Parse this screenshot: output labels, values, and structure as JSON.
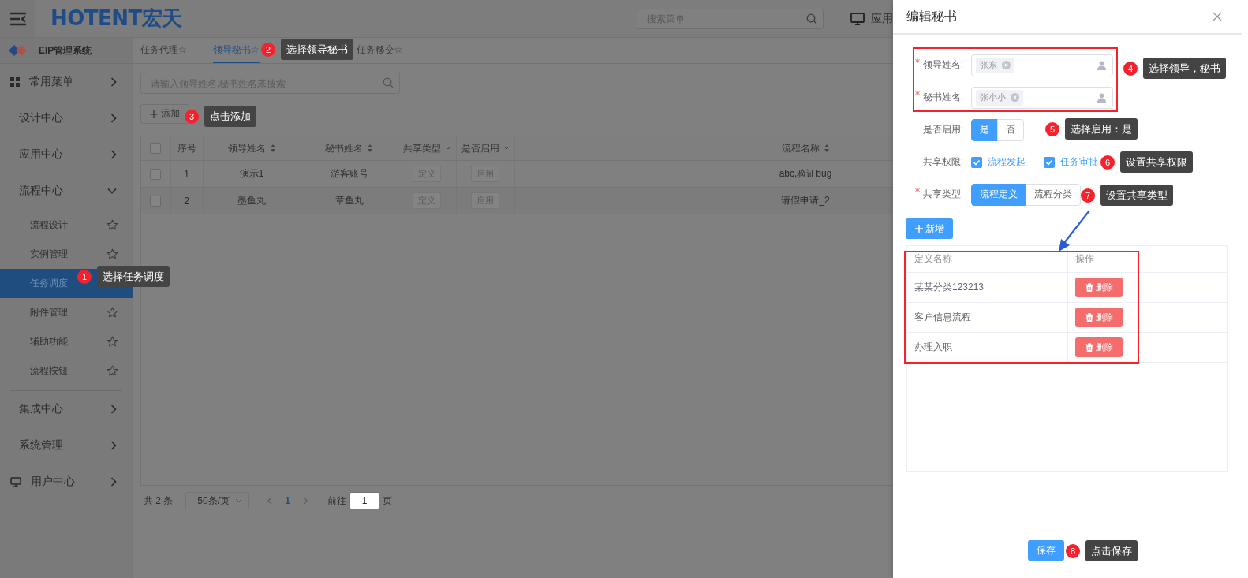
{
  "header": {
    "logo": "HOTENT宏天",
    "search": {
      "placeholder": "搜索菜单"
    },
    "app_link": "应用"
  },
  "sidebar": {
    "brand": "EIP管理系统",
    "items": [
      {
        "label": "常用菜单",
        "kind": "shortcuts",
        "expanded": false
      },
      {
        "label": "设计中心",
        "kind": "group",
        "expanded": false
      },
      {
        "label": "应用中心",
        "kind": "group",
        "expanded": false
      },
      {
        "label": "流程中心",
        "kind": "group",
        "expanded": true,
        "children": [
          {
            "label": "流程设计",
            "selected": false
          },
          {
            "label": "实例管理",
            "selected": false
          },
          {
            "label": "任务调度",
            "selected": true
          },
          {
            "label": "附件管理",
            "selected": false
          },
          {
            "label": "辅助功能",
            "selected": false
          },
          {
            "label": "流程按钮",
            "selected": false
          }
        ]
      },
      {
        "label": "集成中心",
        "kind": "group",
        "expanded": false
      },
      {
        "label": "系统管理",
        "kind": "group",
        "expanded": false
      },
      {
        "label": "用户中心",
        "kind": "account",
        "expanded": false
      }
    ]
  },
  "tabs": [
    {
      "label": "任务代理☆",
      "selected": false
    },
    {
      "label": "领导秘书☆",
      "selected": true
    },
    {
      "label": "任务移交☆",
      "selected": false
    }
  ],
  "search": {
    "placeholder": "请输入领导姓名,秘书姓名来搜索"
  },
  "add_button": "添加",
  "table": {
    "all_checked": false,
    "columns": [
      {
        "label": "序号",
        "kind": "plain"
      },
      {
        "label": "领导姓名",
        "kind": "sortable"
      },
      {
        "label": "秘书姓名",
        "kind": "sortable"
      },
      {
        "label": "共享类型",
        "kind": "filter"
      },
      {
        "label": "是否启用",
        "kind": "filter"
      },
      {
        "label": "流程名称",
        "kind": "sortable"
      }
    ],
    "rows": [
      {
        "checked": false,
        "cells": [
          "1",
          "演示1",
          "游客账号",
          "定义",
          "启用",
          "abc,验证bug"
        ]
      },
      {
        "checked": false,
        "cells": [
          "2",
          "墨鱼丸",
          "章鱼丸",
          "定义",
          "启用",
          "请假申请_2"
        ]
      }
    ]
  },
  "pagination": {
    "total": "共 2 条",
    "page_size": "50条/页",
    "current_page": "1",
    "goto_label": "前往",
    "goto_value": "1",
    "page_unit": "页"
  },
  "drawer": {
    "title": "编辑秘书",
    "fields": [
      {
        "kind": "user-picker",
        "label": "领导姓名:",
        "required": true,
        "value": "张东"
      },
      {
        "kind": "user-picker",
        "label": "秘书姓名:",
        "required": true,
        "value": "张小小"
      },
      {
        "kind": "button-group",
        "label": "是否启用:",
        "required": false,
        "options": [
          {
            "label": "是",
            "selected": true
          },
          {
            "label": "否",
            "selected": false
          }
        ]
      },
      {
        "kind": "checkbox-group",
        "label": "共享权限:",
        "required": false,
        "options": [
          {
            "label": "流程发起",
            "checked": true
          },
          {
            "label": "任务审批",
            "checked": true
          }
        ]
      },
      {
        "kind": "button-group",
        "label": "共享类型:",
        "required": true,
        "options": [
          {
            "label": "流程定义",
            "selected": true
          },
          {
            "label": "流程分类",
            "selected": false
          }
        ]
      }
    ],
    "add_button": "新增",
    "definitions": {
      "columns": [
        "定义名称",
        "操作"
      ],
      "rows": [
        {
          "name": "某某分类123213",
          "action": "删除"
        },
        {
          "name": "客户信息流程",
          "action": "删除"
        },
        {
          "name": "办理入职",
          "action": "删除"
        }
      ]
    },
    "save_button": "保存"
  },
  "annotations": [
    {
      "number": "1",
      "text": "选择任务调度"
    },
    {
      "number": "2",
      "text": "选择领导秘书"
    },
    {
      "number": "3",
      "text": "点击添加"
    },
    {
      "number": "4",
      "text": "选择领导，秘书"
    },
    {
      "number": "5",
      "text": "选择启用：是"
    },
    {
      "number": "6",
      "text": "设置共享权限"
    },
    {
      "number": "7",
      "text": "设置共享类型"
    },
    {
      "number": "8",
      "text": "点击保存"
    }
  ]
}
